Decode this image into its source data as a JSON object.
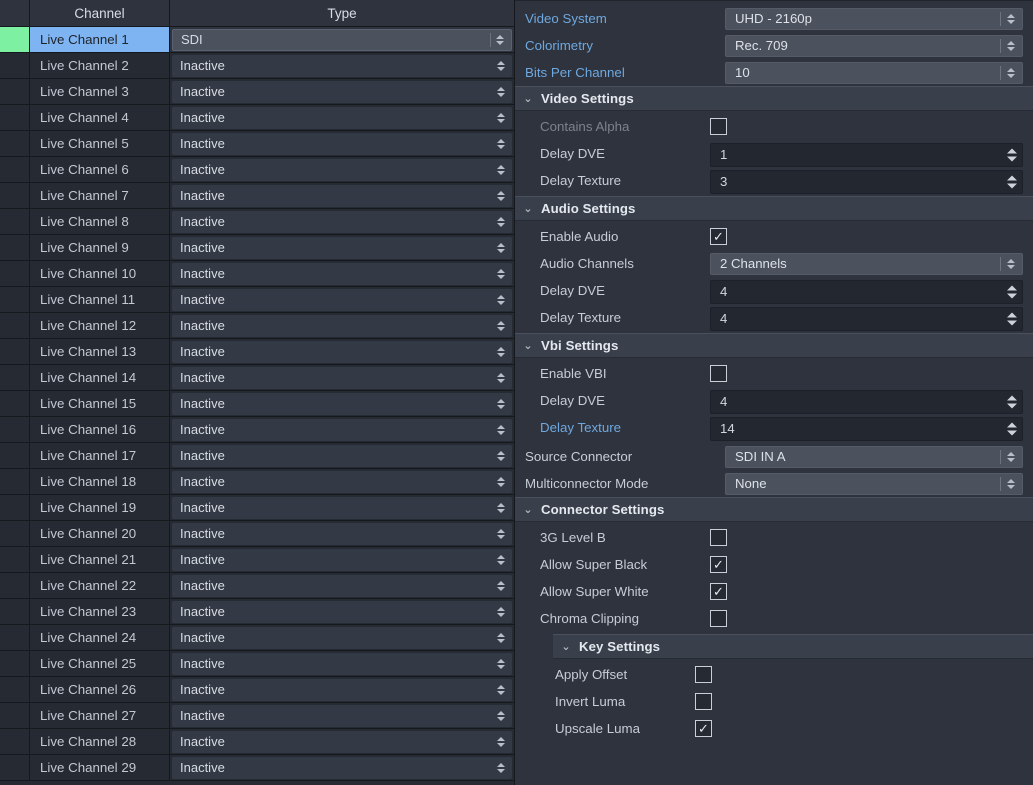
{
  "table": {
    "columns": {
      "indicator": "",
      "channel": "Channel",
      "type": "Type"
    },
    "rows": [
      {
        "name": "Live Channel 1",
        "type": "SDI",
        "selected": true,
        "indicator_color": "#7df0a2"
      },
      {
        "name": "Live Channel 2",
        "type": "Inactive",
        "selected": false
      },
      {
        "name": "Live Channel 3",
        "type": "Inactive",
        "selected": false
      },
      {
        "name": "Live Channel 4",
        "type": "Inactive",
        "selected": false
      },
      {
        "name": "Live Channel 5",
        "type": "Inactive",
        "selected": false
      },
      {
        "name": "Live Channel 6",
        "type": "Inactive",
        "selected": false
      },
      {
        "name": "Live Channel 7",
        "type": "Inactive",
        "selected": false
      },
      {
        "name": "Live Channel 8",
        "type": "Inactive",
        "selected": false
      },
      {
        "name": "Live Channel 9",
        "type": "Inactive",
        "selected": false
      },
      {
        "name": "Live Channel 10",
        "type": "Inactive",
        "selected": false
      },
      {
        "name": "Live Channel 11",
        "type": "Inactive",
        "selected": false
      },
      {
        "name": "Live Channel 12",
        "type": "Inactive",
        "selected": false
      },
      {
        "name": "Live Channel 13",
        "type": "Inactive",
        "selected": false
      },
      {
        "name": "Live Channel 14",
        "type": "Inactive",
        "selected": false
      },
      {
        "name": "Live Channel 15",
        "type": "Inactive",
        "selected": false
      },
      {
        "name": "Live Channel 16",
        "type": "Inactive",
        "selected": false
      },
      {
        "name": "Live Channel 17",
        "type": "Inactive",
        "selected": false
      },
      {
        "name": "Live Channel 18",
        "type": "Inactive",
        "selected": false
      },
      {
        "name": "Live Channel 19",
        "type": "Inactive",
        "selected": false
      },
      {
        "name": "Live Channel 20",
        "type": "Inactive",
        "selected": false
      },
      {
        "name": "Live Channel 21",
        "type": "Inactive",
        "selected": false
      },
      {
        "name": "Live Channel 22",
        "type": "Inactive",
        "selected": false
      },
      {
        "name": "Live Channel 23",
        "type": "Inactive",
        "selected": false
      },
      {
        "name": "Live Channel 24",
        "type": "Inactive",
        "selected": false
      },
      {
        "name": "Live Channel 25",
        "type": "Inactive",
        "selected": false
      },
      {
        "name": "Live Channel 26",
        "type": "Inactive",
        "selected": false
      },
      {
        "name": "Live Channel 27",
        "type": "Inactive",
        "selected": false
      },
      {
        "name": "Live Channel 28",
        "type": "Inactive",
        "selected": false
      },
      {
        "name": "Live Channel 29",
        "type": "Inactive",
        "selected": false
      }
    ]
  },
  "properties": {
    "top": [
      {
        "label": "Video System",
        "value": "UHD - 2160p",
        "control": "combo",
        "label_style": "blue"
      },
      {
        "label": "Colorimetry",
        "value": "Rec. 709",
        "control": "combo",
        "label_style": "blue"
      },
      {
        "label": "Bits Per Channel",
        "value": "10",
        "control": "combo",
        "label_style": "blue"
      }
    ],
    "video_settings": {
      "title": "Video Settings",
      "chevron": "expanded",
      "items": [
        {
          "label": "Contains Alpha",
          "control": "checkbox",
          "checked": false,
          "label_style": "dim"
        },
        {
          "label": "Delay DVE",
          "control": "spin",
          "value": "1"
        },
        {
          "label": "Delay Texture",
          "control": "spin",
          "value": "3"
        }
      ]
    },
    "audio_settings": {
      "title": "Audio Settings",
      "chevron": "expanded",
      "items": [
        {
          "label": "Enable Audio",
          "control": "checkbox",
          "checked": true
        },
        {
          "label": "Audio Channels",
          "control": "combo",
          "value": "2 Channels"
        },
        {
          "label": "Delay DVE",
          "control": "spin",
          "value": "4"
        },
        {
          "label": "Delay Texture",
          "control": "spin",
          "value": "4"
        }
      ]
    },
    "vbi_settings": {
      "title": "Vbi Settings",
      "chevron": "expanded",
      "items": [
        {
          "label": "Enable VBI",
          "control": "checkbox",
          "checked": false
        },
        {
          "label": "Delay DVE",
          "control": "spin",
          "value": "4"
        },
        {
          "label": "Delay Texture",
          "control": "spin",
          "value": "14",
          "label_style": "blue"
        }
      ]
    },
    "connector": [
      {
        "label": "Source Connector",
        "value": "SDI IN A",
        "control": "combo"
      },
      {
        "label": "Multiconnector Mode",
        "value": "None",
        "control": "combo"
      }
    ],
    "connector_settings": {
      "title": "Connector Settings",
      "chevron": "expanded",
      "items": [
        {
          "label": "3G Level B",
          "control": "checkbox",
          "checked": false
        },
        {
          "label": "Allow Super Black",
          "control": "checkbox",
          "checked": true
        },
        {
          "label": "Allow Super White",
          "control": "checkbox",
          "checked": true
        },
        {
          "label": "Chroma Clipping",
          "control": "checkbox",
          "checked": false
        }
      ]
    },
    "key_settings": {
      "title": "Key Settings",
      "chevron": "expanded",
      "items": [
        {
          "label": "Apply Offset",
          "control": "checkbox",
          "checked": false
        },
        {
          "label": "Invert Luma",
          "control": "checkbox",
          "checked": false
        },
        {
          "label": "Upscale Luma",
          "control": "checkbox",
          "checked": true
        }
      ]
    }
  },
  "glyphs": {
    "chevron_down": "⌄",
    "check": "✓"
  },
  "colors": {
    "selection_blue": "#7eb4f2",
    "indicator_green": "#7df0a2",
    "label_blue": "#6fa8e0",
    "panel_bg": "#2e333d",
    "table_bg": "#262a32",
    "section_bg": "#3a404b"
  }
}
